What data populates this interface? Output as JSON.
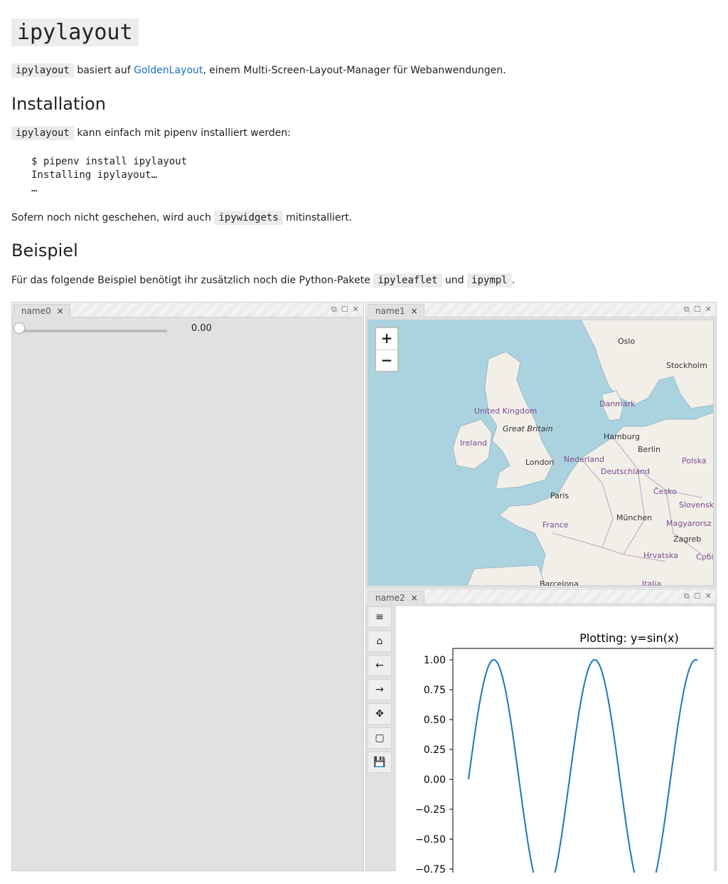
{
  "title": "ipylayout",
  "intro": {
    "code": "ipylayout",
    "text1": "basiert auf",
    "link": "GoldenLayout",
    "text2": ", einem Multi-Screen-Layout-Manager für Webanwendungen."
  },
  "installation": {
    "heading": "Installation",
    "code": "ipylayout",
    "text": "kann einfach mit pipenv installiert werden:",
    "lines": [
      "$ pipenv install ipylayout",
      "Installing ipylayout…",
      "…"
    ],
    "note1": "Sofern noch nicht geschehen, wird auch",
    "note_code": "ipywidgets",
    "note2": "mitinstalliert."
  },
  "beispiel": {
    "heading": "Beispiel",
    "text1": "Für das folgende Beispiel benötigt ihr zusätzlich noch die Python-Pakete",
    "code1": "ipyleaflet",
    "text2": "und",
    "code2": "ipympl",
    "text3": "."
  },
  "panels": {
    "name0": {
      "tab": "name0",
      "slider_value": "0.00",
      "slider_fraction": 0
    },
    "name1": {
      "tab": "name1",
      "zoom_in": "+",
      "zoom_out": "−"
    },
    "name2": {
      "tab": "name2"
    }
  },
  "panel_controls": {
    "popout": "⧉",
    "maximize": "☐",
    "close": "✕",
    "tab_close": "×"
  },
  "map_labels": [
    {
      "text": "Oslo",
      "type": "city"
    },
    {
      "text": "Stockholm",
      "type": "city"
    },
    {
      "text": "Danmark",
      "type": "country"
    },
    {
      "text": "United Kingdom",
      "type": "country"
    },
    {
      "text": "Great Britain",
      "type": "island"
    },
    {
      "text": "Ireland",
      "type": "country"
    },
    {
      "text": "Hamburg",
      "type": "city"
    },
    {
      "text": "Berlin",
      "type": "city"
    },
    {
      "text": "Polska",
      "type": "country"
    },
    {
      "text": "London",
      "type": "city"
    },
    {
      "text": "Nederland",
      "type": "country"
    },
    {
      "text": "Deutschland",
      "type": "country"
    },
    {
      "text": "Paris",
      "type": "city"
    },
    {
      "text": "Česko",
      "type": "country"
    },
    {
      "text": "Slovensk",
      "type": "country"
    },
    {
      "text": "France",
      "type": "country"
    },
    {
      "text": "München",
      "type": "city"
    },
    {
      "text": "Magyarorsz",
      "type": "country"
    },
    {
      "text": "Zagreb",
      "type": "city"
    },
    {
      "text": "Hrvatska",
      "type": "country"
    },
    {
      "text": "Србі",
      "type": "country"
    },
    {
      "text": "Barcelona",
      "type": "city"
    },
    {
      "text": "Italia",
      "type": "country"
    }
  ],
  "toolbar_icons": [
    "menu-icon",
    "home-icon",
    "back-arrow-icon",
    "forward-arrow-icon",
    "pan-icon",
    "zoom-rect-icon",
    "save-icon"
  ],
  "toolbar_glyphs": [
    "≡",
    "⌂",
    "←",
    "→",
    "✥",
    "▢",
    "💾"
  ],
  "colors": {
    "line": "#1f77b4",
    "link": "#1a6fc4",
    "panel_bg": "#e1e1e1",
    "map_water": "#aad3df",
    "map_land": "#f2efe9"
  },
  "chart_data": {
    "type": "line",
    "title": "Plotting: y=sin(x)",
    "xlabel": "",
    "ylabel": "",
    "ylim": [
      -0.75,
      1.1
    ],
    "yticks": [
      "1.00",
      "0.75",
      "0.50",
      "0.25",
      "0.00",
      "−0.25",
      "−0.50",
      "−0.75"
    ],
    "ytick_values": [
      1.0,
      0.75,
      0.5,
      0.25,
      0.0,
      -0.25,
      -0.5,
      -0.75
    ],
    "function": "sin",
    "x_range": [
      0,
      14.3
    ],
    "series": [
      {
        "values_description": null
      }
    ]
  }
}
